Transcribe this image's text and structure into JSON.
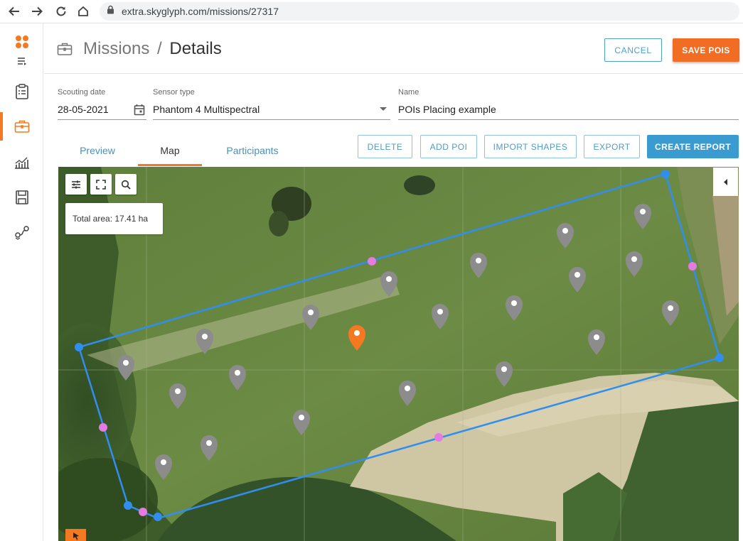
{
  "browser": {
    "url": "extra.skyglyph.com/missions/27317"
  },
  "header": {
    "breadcrumb_root": "Missions",
    "breadcrumb_sep": "/",
    "breadcrumb_current": "Details",
    "cancel_label": "CANCEL",
    "save_label": "SAVE POIS"
  },
  "form": {
    "scouting_date_label": "Scouting date",
    "scouting_date_value": "28-05-2021",
    "sensor_type_label": "Sensor type",
    "sensor_type_value": "Phantom 4 Multispectral",
    "name_label": "Name",
    "name_value": "POIs Placing example"
  },
  "tabs": [
    {
      "label": "Preview",
      "active": false
    },
    {
      "label": "Map",
      "active": true
    },
    {
      "label": "Participants",
      "active": false
    }
  ],
  "actions": {
    "delete": "DELETE",
    "add_poi": "ADD POI",
    "import_shapes": "IMPORT SHAPES",
    "export": "EXPORT",
    "create_report": "CREATE REPORT"
  },
  "map": {
    "total_area": "Total area: 17.41 ha",
    "poi_count_gray": 22,
    "poi_count_selected": 1
  },
  "colors": {
    "accent": "#f47920",
    "primary": "#3a9bd1",
    "polygon": "#2f8ef0",
    "midpoint": "#e47be0",
    "poi": "#8c8c8c"
  },
  "icons": {
    "back": "back-arrow-icon",
    "forward": "forward-arrow-icon",
    "reload": "reload-icon",
    "home": "home-icon",
    "lock": "lock-icon",
    "calendar": "calendar-icon",
    "dropdown": "caret-down-icon"
  }
}
